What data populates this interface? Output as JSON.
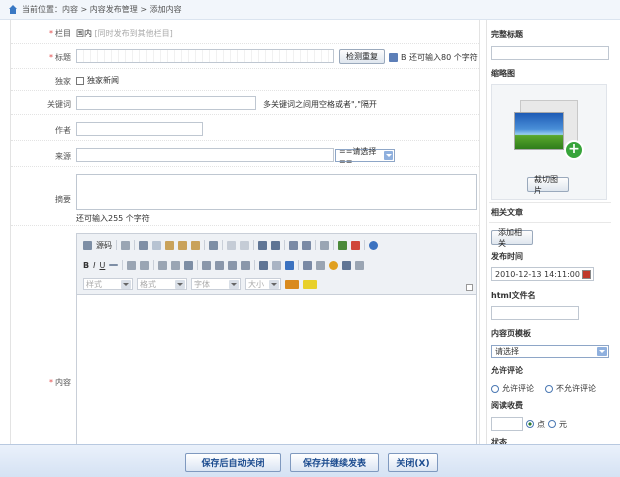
{
  "breadcrumb": {
    "text": "当前位置：内容 > 内容发布管理 > 添加内容"
  },
  "form": {
    "column": {
      "label": "栏目",
      "value": "国内",
      "link": "[同时发布到其他栏目]"
    },
    "title": {
      "label": "标题",
      "check_button": "检测重复",
      "counter": "B 还可输入80 个字符"
    },
    "flag": {
      "label": "独家",
      "option": "独家新闻"
    },
    "keywords": {
      "label": "关键词",
      "hint": "多关键词之间用空格或者\",\"隔开"
    },
    "author": {
      "label": "作者"
    },
    "source": {
      "label": "来源",
      "select": "==请选择=="
    },
    "summary": {
      "label": "摘要",
      "counter": "还可输入255 个字符"
    },
    "content": {
      "label": "内容"
    }
  },
  "editor": {
    "source_label": "源码",
    "combos": [
      "样式",
      "格式",
      "字体",
      "大小"
    ]
  },
  "sidebar": {
    "complete_title_label": "完整标题",
    "thumbnail_label": "缩略图",
    "crop_button": "裁切图片",
    "related_label": "相关文章",
    "add_related_button": "添加相关",
    "publish_time_label": "发布时间",
    "publish_time_value": "2010-12-13 14:11:00",
    "html_file_label": "html文件名",
    "template_label": "内容页模板",
    "template_select": "请选择",
    "comment_label": "允许评论",
    "comment_allow": "允许评论",
    "comment_deny": "不允许评论",
    "read_fee_label": "阅读收费",
    "fee_point": "点",
    "fee_yuan": "元",
    "more_label": "状态"
  },
  "footer": {
    "save_close": "保存后自动关闭",
    "save_continue": "保存并继续发表",
    "close": "关闭(X)"
  }
}
